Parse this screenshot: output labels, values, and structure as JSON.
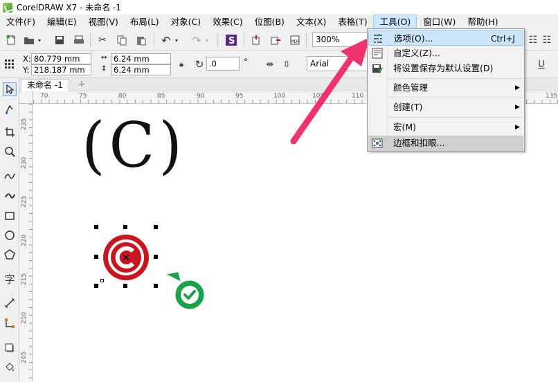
{
  "window": {
    "title": "CorelDRAW X7 - 未命名 -1"
  },
  "menubar": {
    "items": [
      {
        "label": "文件(F)"
      },
      {
        "label": "编辑(E)"
      },
      {
        "label": "视图(V)"
      },
      {
        "label": "布局(L)"
      },
      {
        "label": "对象(C)"
      },
      {
        "label": "效果(C)"
      },
      {
        "label": "位图(B)"
      },
      {
        "label": "文本(X)"
      },
      {
        "label": "表格(T)"
      },
      {
        "label": "工具(O)"
      },
      {
        "label": "窗口(W)"
      },
      {
        "label": "帮助(H)"
      }
    ],
    "active_item": "工具(O)"
  },
  "toolbar": {
    "zoom_value": "300%"
  },
  "property_bar": {
    "x_label": "X:",
    "x_value": "80.779 mm",
    "y_label": "Y:",
    "y_value": "218.187 mm",
    "width_value": "6.24 mm",
    "height_value": "6.24 mm",
    "rotation_value": ".0",
    "degree_symbol": "°",
    "font_name": "Arial"
  },
  "document": {
    "tab_label": "未命名 -1",
    "add_tab_symbol": "+"
  },
  "ruler": {
    "h_labels": [
      "70",
      "75",
      "80",
      "85",
      "90",
      "95",
      "100",
      "105",
      "110",
      "135"
    ],
    "v_labels": [
      "235",
      "230",
      "225",
      "220",
      "215",
      "210",
      "205"
    ]
  },
  "canvas": {
    "text_object": "(C)",
    "copyright_symbol": "©"
  },
  "tools_menu": {
    "items": [
      {
        "label": "选项(O)...",
        "shortcut": "Ctrl+J",
        "icon": "options-icon"
      },
      {
        "label": "自定义(Z)...",
        "shortcut": "",
        "icon": "customize-icon"
      },
      {
        "label": "将设置保存为默认设置(D)",
        "shortcut": "",
        "icon": "save-settings-icon"
      },
      {
        "label": "颜色管理",
        "shortcut": "",
        "icon": ""
      },
      {
        "label": "创建(T)",
        "shortcut": "",
        "icon": ""
      },
      {
        "label": "宏(M)",
        "shortcut": "",
        "icon": ""
      },
      {
        "label": "边框和扣眼...",
        "shortcut": "",
        "icon": "border-grommet-icon"
      }
    ],
    "submenu_arrow": "▶"
  },
  "colors": {
    "accent_arrow": "#f0336e",
    "copyright_red": "#c8161e",
    "check_green": "#1aa34a",
    "menu_highlight": "#cce5fb"
  }
}
